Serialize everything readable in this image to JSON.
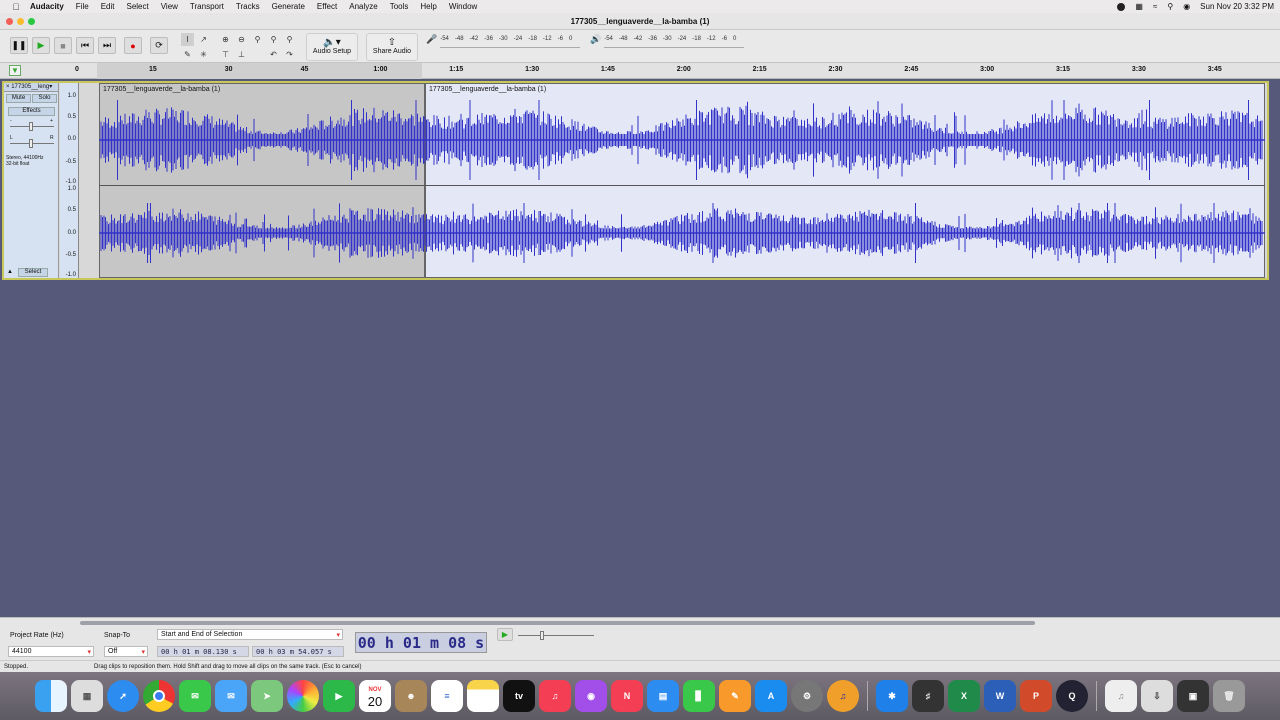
{
  "menubar": {
    "app": "Audacity",
    "items": [
      "File",
      "Edit",
      "Select",
      "View",
      "Transport",
      "Tracks",
      "Generate",
      "Effect",
      "Analyze",
      "Tools",
      "Help",
      "Window"
    ],
    "datetime": "Sun Nov 20  3:32 PM"
  },
  "window": {
    "title": "177305__lenguaverde__la-bamba (1)"
  },
  "toolbar": {
    "audio_setup_label": "Audio Setup",
    "share_audio_label": "Share Audio",
    "record_meter_ticks": [
      "-54",
      "-48",
      "-42",
      "-36",
      "-30",
      "-24",
      "-18",
      "-12",
      "-6",
      "0"
    ],
    "play_meter_ticks": [
      "-54",
      "-48",
      "-42",
      "-36",
      "-30",
      "-24",
      "-18",
      "-12",
      "-6",
      "0"
    ]
  },
  "ruler": {
    "ticks": [
      "0",
      "15",
      "30",
      "45",
      "1:00",
      "1:15",
      "1:30",
      "1:45",
      "2:00",
      "2:15",
      "2:30",
      "2:45",
      "3:00",
      "3:15",
      "3:30",
      "3:45"
    ]
  },
  "track": {
    "name": "177305__leng",
    "mute_label": "Mute",
    "solo_label": "Solo",
    "effects_label": "Effects",
    "format_line1": "Stereo, 44100Hz",
    "format_line2": "32-bit float",
    "select_label": "Select",
    "scale_top": [
      "1.0",
      "0.5",
      "0.0",
      "-0.5",
      "-1.0"
    ],
    "scale_bottom": [
      "1.0",
      "0.5",
      "0.0",
      "-0.5",
      "-1.0"
    ],
    "gain_l": "-",
    "gain_r": "+",
    "pan_l": "L",
    "pan_r": "R",
    "clips": [
      {
        "name": "177305__lenguaverde__la-bamba (1)"
      },
      {
        "name": "177305__lenguaverde__la-bamba (1)"
      }
    ]
  },
  "selection_toolbar": {
    "project_rate_label": "Project Rate (Hz)",
    "project_rate_value": "44100",
    "snap_to_label": "Snap-To",
    "snap_to_value": "Off",
    "selection_mode": "Start and End of Selection",
    "start_time": "00 h 01 m 08.130 s",
    "end_time": "00 h 03 m 54.057 s",
    "big_time": "00 h 01 m 08 s"
  },
  "status": {
    "state": "Stopped.",
    "hint": "Drag clips to reposition them. Hold Shift and drag to move all clips on the same track. (Esc to cancel)"
  },
  "dock": {
    "calendar_month": "NOV",
    "calendar_day": "20",
    "apps": [
      "Finder",
      "Launchpad",
      "Safari",
      "Chrome",
      "Messages",
      "Mail",
      "Maps",
      "Photos",
      "FaceTime",
      "Calendar",
      "Contacts",
      "Reminders",
      "Notes",
      "Apple TV",
      "Music",
      "Podcasts",
      "News",
      "Keynote",
      "Numbers",
      "Pages",
      "App Store",
      "System Preferences",
      "Audacity",
      "Bluetooth",
      "GarageBand",
      "Excel",
      "Word",
      "PowerPoint",
      "QuickTime",
      "Preview",
      "Downloads",
      "Screenshot",
      "Trash"
    ]
  },
  "colors": {
    "waveform": "#3232c8",
    "background": "#56597a",
    "selection": "#c6c6c6",
    "clip_bg": "#e4e8f6"
  }
}
